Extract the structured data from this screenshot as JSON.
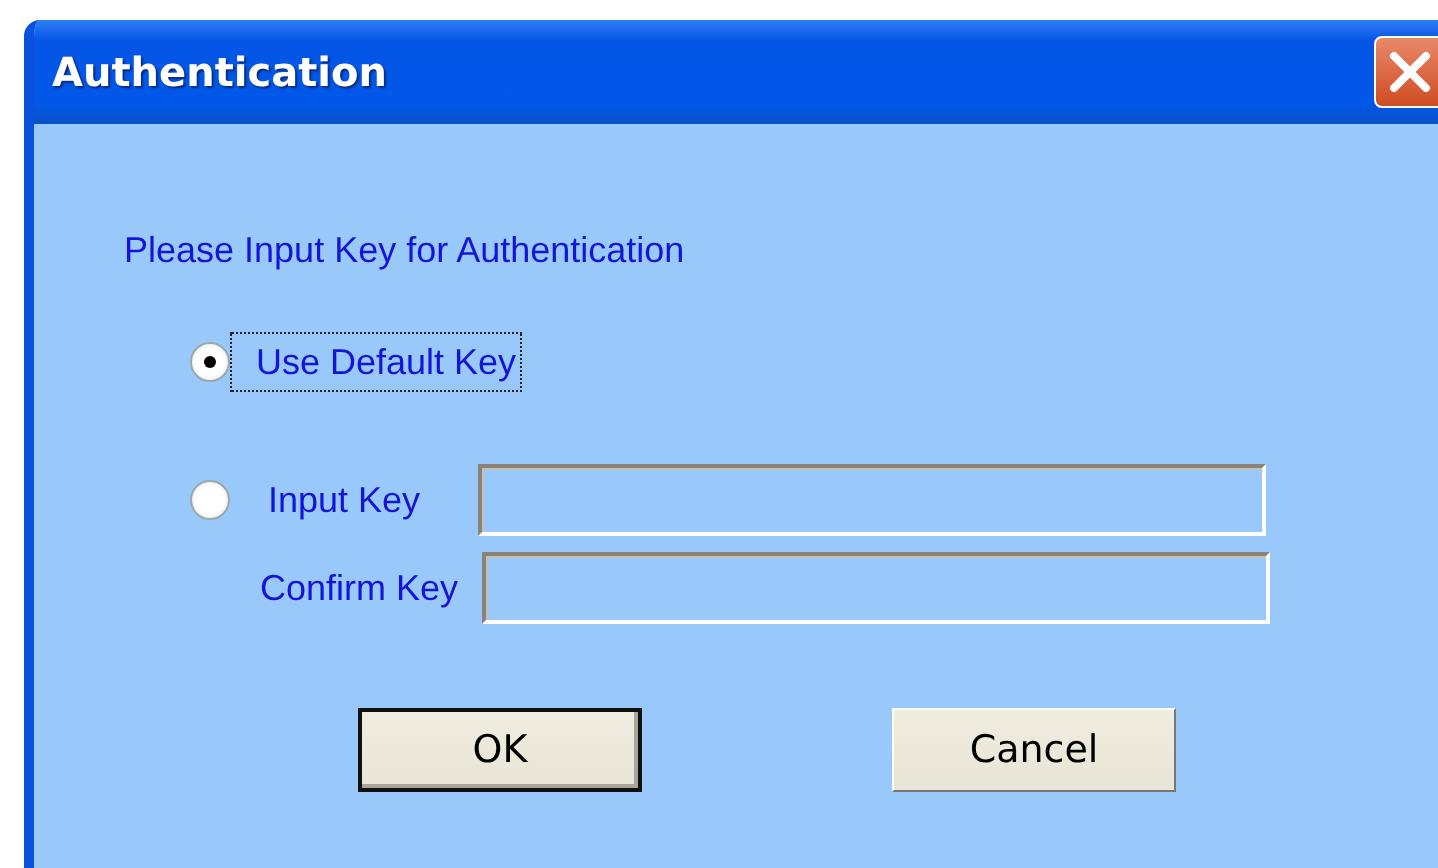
{
  "window": {
    "title": "Authentication"
  },
  "prompt": "Please Input Key for Authentication",
  "options": [
    {
      "label": "Use Default Key",
      "selected": true,
      "focused": true
    },
    {
      "label": "Input Key",
      "selected": false,
      "focused": false
    }
  ],
  "confirm_label": "Confirm Key",
  "buttons": [
    {
      "label": "OK",
      "default": true
    },
    {
      "label": "Cancel",
      "default": false
    }
  ]
}
